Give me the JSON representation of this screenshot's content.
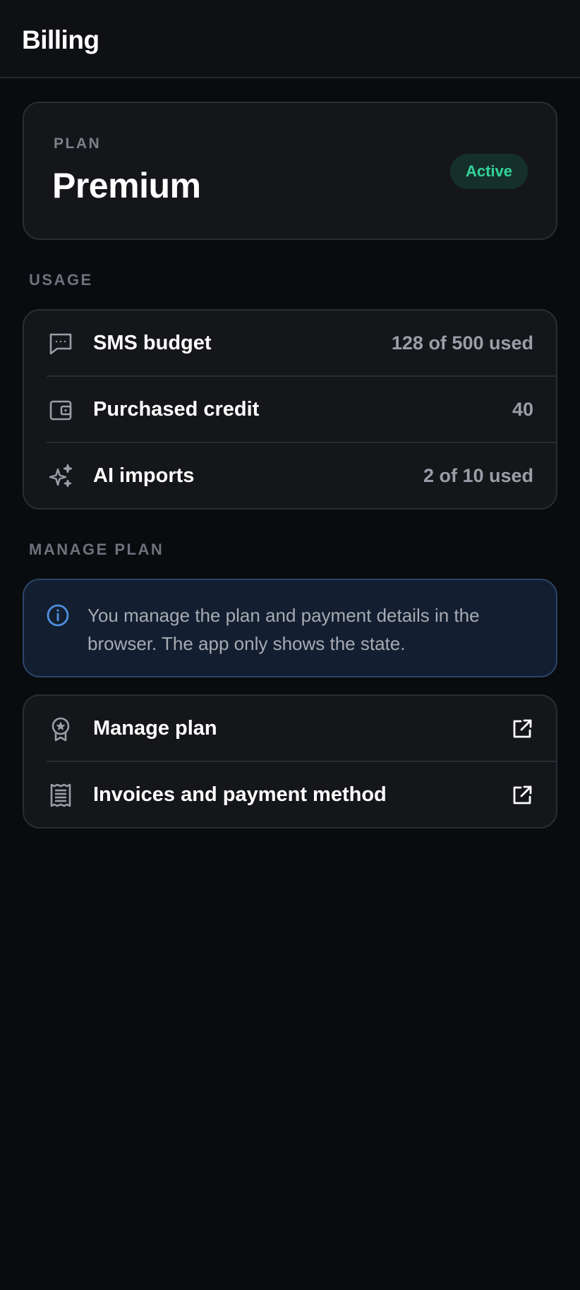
{
  "header": {
    "title": "Billing"
  },
  "plan": {
    "label": "PLAN",
    "name": "Premium",
    "status": "Active",
    "status_color": "#34d39a"
  },
  "usage": {
    "section_label": "USAGE",
    "items": [
      {
        "icon": "message-icon",
        "label": "SMS budget",
        "value": "128 of 500 used"
      },
      {
        "icon": "wallet-icon",
        "label": "Purchased credit",
        "value": "40"
      },
      {
        "icon": "sparkles-icon",
        "label": "AI imports",
        "value": "2 of 10 used"
      }
    ]
  },
  "manage": {
    "section_label": "MANAGE PLAN",
    "info_text": "You manage the plan and payment details in the browser. The app only shows the state.",
    "items": [
      {
        "icon": "award-icon",
        "label": "Manage plan",
        "action_icon": "external-link-icon"
      },
      {
        "icon": "receipt-icon",
        "label": "Invoices and payment method",
        "action_icon": "external-link-icon"
      }
    ]
  },
  "colors": {
    "background": "#0a0b0f",
    "card": "#15161a",
    "info_accent": "#4f8fdf"
  }
}
